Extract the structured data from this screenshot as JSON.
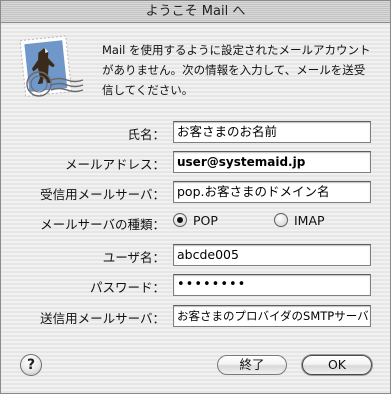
{
  "window": {
    "title": "ようこそ Mail へ"
  },
  "icon": {
    "semantic": "mail-stamp-eagle-icon"
  },
  "intro": {
    "text": "Mail を使用するように設定されたメールアカウントがありません。次の情報を入力して、メールを送受信してください。"
  },
  "form": {
    "name": {
      "label": "氏名：",
      "value": "お客さまのお名前"
    },
    "email": {
      "label": "メールアドレス：",
      "value": "user@systemaid.jp"
    },
    "incoming_server": {
      "label": "受信用メールサーバ：",
      "value": "pop.お客さまのドメイン名"
    },
    "server_type": {
      "label": "メールサーバの種類：",
      "options": [
        "POP",
        "IMAP"
      ],
      "selected": "POP"
    },
    "username": {
      "label": "ユーザ名：",
      "value": "abcde005"
    },
    "password": {
      "label": "パスワード：",
      "value": "••••••••"
    },
    "outgoing_server": {
      "label": "送信用メールサーバ：",
      "value": "お客さまのプロバイダのSMTPサーバ"
    }
  },
  "buttons": {
    "help": "?",
    "quit": "終了",
    "ok": "OK"
  }
}
